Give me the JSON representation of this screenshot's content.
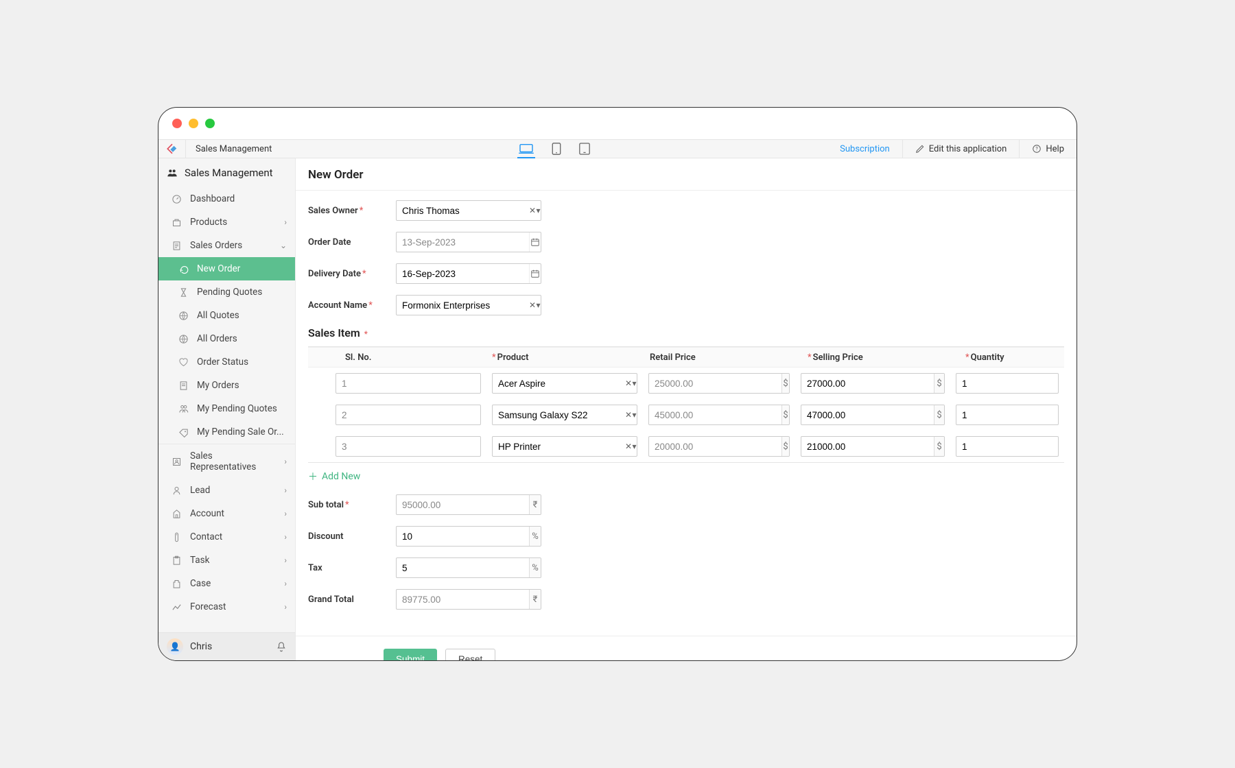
{
  "toolbar": {
    "app_title": "Sales Management",
    "subscription": "Subscription",
    "edit_app": "Edit this application",
    "help": "Help"
  },
  "sidebar": {
    "header": "Sales Management",
    "items": [
      {
        "label": "Dashboard",
        "icon": "dashboard-icon"
      },
      {
        "label": "Products",
        "icon": "products-icon",
        "chev": true
      },
      {
        "label": "Sales Orders",
        "icon": "orders-icon",
        "chev": true,
        "expanded": true
      },
      {
        "label": "New Order",
        "icon": "new-order-icon",
        "level": 2,
        "active": true
      },
      {
        "label": "Pending Quotes",
        "icon": "pending-icon",
        "level": 2
      },
      {
        "label": "All Quotes",
        "icon": "quotes-icon",
        "level": 2
      },
      {
        "label": "All Orders",
        "icon": "allorders-icon",
        "level": 2
      },
      {
        "label": "Order Status",
        "icon": "status-icon",
        "level": 2
      },
      {
        "label": "My Orders",
        "icon": "myorders-icon",
        "level": 2
      },
      {
        "label": "My Pending Quotes",
        "icon": "mypending-icon",
        "level": 2
      },
      {
        "label": "My Pending Sale Or...",
        "icon": "mypendingsale-icon",
        "level": 2
      },
      {
        "label": "Sales Representatives",
        "icon": "reps-icon",
        "chev": true
      },
      {
        "label": "Lead",
        "icon": "lead-icon",
        "chev": true
      },
      {
        "label": "Account",
        "icon": "account-icon",
        "chev": true
      },
      {
        "label": "Contact",
        "icon": "contact-icon",
        "chev": true
      },
      {
        "label": "Task",
        "icon": "task-icon",
        "chev": true
      },
      {
        "label": "Case",
        "icon": "case-icon",
        "chev": true
      },
      {
        "label": "Forecast",
        "icon": "forecast-icon",
        "chev": true
      }
    ],
    "user": "Chris"
  },
  "page": {
    "title": "New Order",
    "fields": {
      "sales_owner": {
        "label": "Sales Owner",
        "value": "Chris Thomas"
      },
      "order_date": {
        "label": "Order Date",
        "value": "13-Sep-2023"
      },
      "delivery_date": {
        "label": "Delivery Date",
        "value": "16-Sep-2023"
      },
      "account_name": {
        "label": "Account Name",
        "value": "Formonix Enterprises"
      }
    },
    "sales_item_heading": "Sales Item",
    "columns": {
      "sl": "Sl. No.",
      "product": "Product",
      "retail": "Retail Price",
      "selling": "Selling Price",
      "qty": "Quantity"
    },
    "rows": [
      {
        "sl": "1",
        "product": "Acer Aspire",
        "retail": "25000.00",
        "selling": "27000.00",
        "qty": "1"
      },
      {
        "sl": "2",
        "product": "Samsung Galaxy S22",
        "retail": "45000.00",
        "selling": "47000.00",
        "qty": "1"
      },
      {
        "sl": "3",
        "product": "HP Printer",
        "retail": "20000.00",
        "selling": "21000.00",
        "qty": "1"
      }
    ],
    "add_new": "Add New",
    "totals": {
      "subtotal": {
        "label": "Sub total",
        "value": "95000.00"
      },
      "discount": {
        "label": "Discount",
        "value": "10"
      },
      "tax": {
        "label": "Tax",
        "value": "5"
      },
      "grand": {
        "label": "Grand Total",
        "value": "89775.00"
      }
    },
    "buttons": {
      "submit": "Submit",
      "reset": "Reset"
    },
    "symbols": {
      "currency": "$",
      "rupee": "₹",
      "percent": "%"
    }
  }
}
